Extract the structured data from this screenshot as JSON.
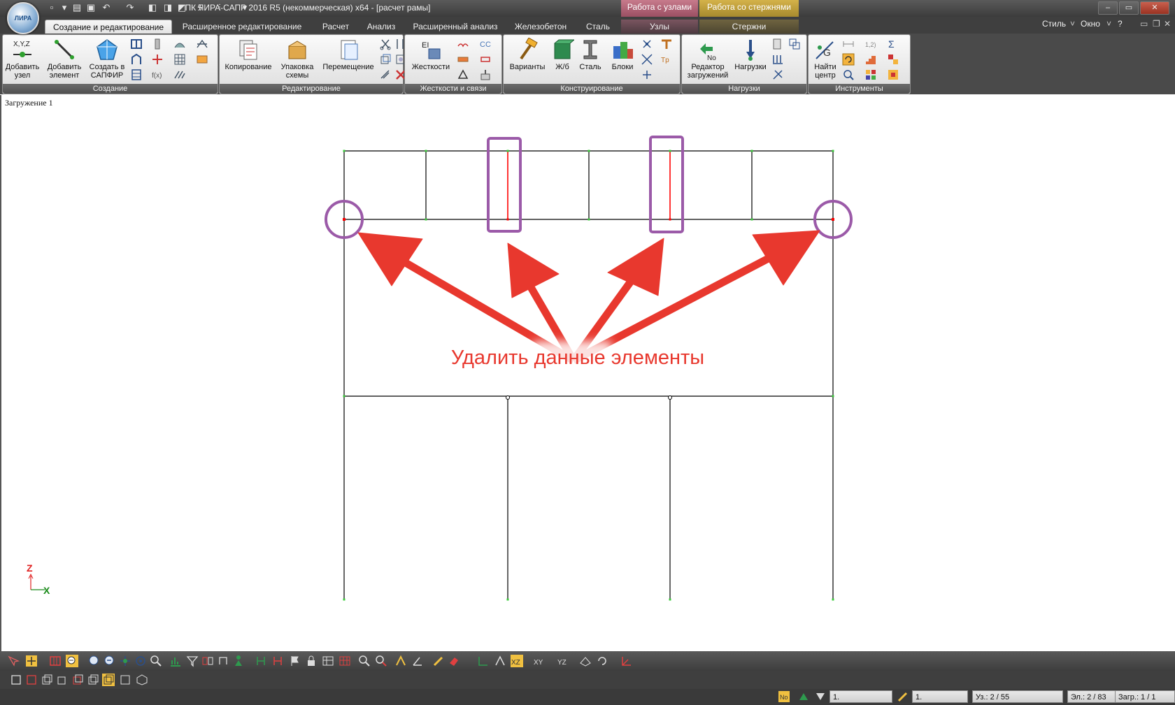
{
  "window": {
    "title": "ПК ЛИРА-САПР  2016 R5 (некоммерческая) x64 - [расчет рамы]",
    "logo_text": "ЛИРА",
    "context_groups": [
      "Работа с узлами",
      "Работа со стержнями"
    ],
    "controls": [
      "–",
      "▭",
      "✕"
    ]
  },
  "tabs": [
    "Создание и редактирование",
    "Расширенное редактирование",
    "Расчет",
    "Анализ",
    "Расширенный анализ",
    "Железобетон",
    "Сталь",
    "Узлы",
    "Стержни"
  ],
  "active_tab": "Создание и редактирование",
  "right_menu": {
    "style": "Стиль",
    "window": "Окно",
    "help": "?"
  },
  "ribbon": {
    "groups": [
      {
        "label": "Создание",
        "buttons": [
          "Добавить\nузел",
          "Добавить\nэлемент",
          "Создать в\nСАПФИР"
        ]
      },
      {
        "label": "Редактирование",
        "buttons": [
          "Копирование",
          "Упаковка\nсхемы",
          "Перемещение"
        ]
      },
      {
        "label": "Жесткости и связи",
        "buttons": [
          "Жесткости"
        ]
      },
      {
        "label": "Конструирование",
        "buttons": [
          "Варианты",
          "Ж/б",
          "Сталь",
          "Блоки"
        ]
      },
      {
        "label": "Нагрузки",
        "buttons": [
          "Редактор\nзагружений",
          "Нагрузки"
        ]
      },
      {
        "label": "Инструменты",
        "buttons": [
          "Найти\nцентр"
        ]
      }
    ]
  },
  "canvas": {
    "load_case": "Загружение 1",
    "annotation": "Удалить данные элементы",
    "axis": {
      "z": "Z",
      "x": "X"
    }
  },
  "status_bar": {
    "combo1": "1.",
    "combo2": "1.",
    "nodes": "Уз.: 2 / 55",
    "elements": "Эл.: 2 / 83",
    "loads": "Загр.: 1 / 1"
  },
  "colors": {
    "annotation_red": "#e8382e",
    "highlight_purple": "#9b5aa8",
    "node_green": "#3ccc3c",
    "selected_red": "#ff0000"
  }
}
